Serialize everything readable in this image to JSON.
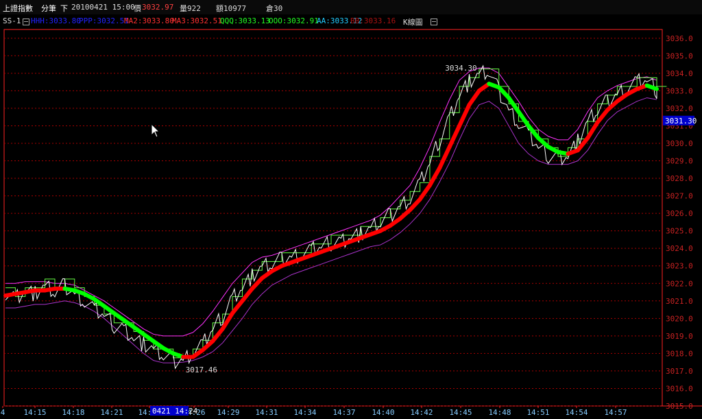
{
  "header": {
    "symbol": "上證指數",
    "period": "分筆",
    "direction": "下",
    "datetime": "20100421 15:00",
    "price_label": "價",
    "price_value": "3032.97",
    "volume": "量922",
    "amount": "額10977",
    "position": "倉30"
  },
  "legend": {
    "chart_name": "SS-1",
    "items": [
      {
        "text": "HHH:3033.80",
        "color": "#2222ff"
      },
      {
        "text": "PPP:3032.51",
        "color": "#2222ff"
      },
      {
        "text": "MA2:3033.80",
        "color": "#ff3030"
      },
      {
        "text": "MA3:3032.51",
        "color": "#ff3030"
      },
      {
        "text": "QQQ:3033.13",
        "color": "#22ff22"
      },
      {
        "text": "OOO:3032.91",
        "color": "#22ff22"
      },
      {
        "text": "AA:3033.12",
        "color": "#22ccff"
      },
      {
        "text": "BB:3033.16",
        "color": "#aa1111"
      },
      {
        "text": "K線圖",
        "color": "#dddddd"
      }
    ]
  },
  "colors": {
    "axis": "#ff2222",
    "grid": "#aa0000",
    "price_line": "#ffffff",
    "ma_up": "#ff0000",
    "ma_down": "#00ff00",
    "band_upper": "#ff33ff",
    "band_lower": "#aa33cc",
    "step_line": "#66ff44",
    "y_tick_text": "#cc2222",
    "x_tick_text": "#88ccff"
  },
  "chart_data": {
    "type": "line",
    "ylim": [
      3015,
      3036.5
    ],
    "y_ticks": [
      "3015.0",
      "3016.0",
      "3017.0",
      "3018.0",
      "3019.0",
      "3020.0",
      "3021.0",
      "3022.0",
      "3023.0",
      "3024.0",
      "3025.0",
      "3026.0",
      "3027.0",
      "3028.0",
      "3029.0",
      "3030.0",
      "3031.0",
      "3032.0",
      "3033.0",
      "3034.0",
      "3035.0",
      "3036.0"
    ],
    "x_ticks": [
      "4",
      "14:15",
      "14:18",
      "14:21",
      "14:24",
      "14:26",
      "14:29",
      "14:31",
      "14:34",
      "14:37",
      "14:40",
      "14:42",
      "14:45",
      "14:48",
      "14:51",
      "14:54",
      "14:57"
    ],
    "cursor_time": "0421 14:24",
    "current_value": "3031.30",
    "annotations": [
      {
        "text": "3017.46",
        "value": 3017.46,
        "label": "low"
      },
      {
        "text": "3034.30",
        "value": 3034.3,
        "label": "high"
      }
    ],
    "series": [
      {
        "name": "MA2",
        "values": [
          3021.3,
          3021.4,
          3021.5,
          3021.6,
          3021.6,
          3021.7,
          3021.7,
          3021.6,
          3021.4,
          3021.1,
          3020.7,
          3020.3,
          3019.9,
          3019.5,
          3019.1,
          3018.7,
          3018.3,
          3018.0,
          3017.8,
          3017.8,
          3018.2,
          3018.7,
          3019.4,
          3020.3,
          3021.0,
          3021.7,
          3022.3,
          3022.7,
          3023.0,
          3023.2,
          3023.4,
          3023.6,
          3023.8,
          3024.0,
          3024.2,
          3024.4,
          3024.6,
          3024.8,
          3025.0,
          3025.3,
          3025.7,
          3026.2,
          3026.8,
          3027.6,
          3028.6,
          3029.8,
          3031.0,
          3032.2,
          3033.0,
          3033.4,
          3033.2,
          3032.6,
          3031.8,
          3031.0,
          3030.3,
          3029.8,
          3029.5,
          3029.4,
          3029.6,
          3030.3,
          3031.2,
          3031.9,
          3032.4,
          3032.8,
          3033.1,
          3033.3,
          3033.1
        ]
      },
      {
        "name": "Price",
        "values": [
          3021.5,
          3021.2,
          3021.6,
          3021.4,
          3021.8,
          3021.5,
          3021.9,
          3021.4,
          3021.0,
          3020.5,
          3020.2,
          3019.6,
          3019.4,
          3018.9,
          3018.5,
          3018.2,
          3017.9,
          3017.6,
          3017.6,
          3018.1,
          3018.5,
          3019.4,
          3020.1,
          3021.2,
          3021.8,
          3022.4,
          3022.9,
          3023.1,
          3023.4,
          3023.5,
          3023.7,
          3023.9,
          3024.1,
          3024.3,
          3024.4,
          3024.7,
          3024.8,
          3025.1,
          3025.5,
          3025.9,
          3026.4,
          3026.9,
          3027.7,
          3028.9,
          3030.2,
          3031.5,
          3032.8,
          3033.5,
          3033.9,
          3034.1,
          3033.0,
          3031.9,
          3031.2,
          3030.5,
          3029.8,
          3029.3,
          3029.2,
          3029.3,
          3030.1,
          3031.2,
          3031.9,
          3032.4,
          3032.8,
          3033.2,
          3033.5,
          3033.6,
          3033.0
        ]
      },
      {
        "name": "Upper",
        "values": [
          3022.0,
          3022.0,
          3022.1,
          3022.1,
          3022.1,
          3022.0,
          3022.0,
          3021.9,
          3021.6,
          3021.3,
          3021.0,
          3020.6,
          3020.2,
          3019.8,
          3019.4,
          3019.1,
          3019.0,
          3019.0,
          3019.0,
          3019.2,
          3019.7,
          3020.4,
          3021.2,
          3022.0,
          3022.6,
          3023.2,
          3023.5,
          3023.6,
          3023.8,
          3024.0,
          3024.2,
          3024.4,
          3024.6,
          3024.8,
          3025.0,
          3025.2,
          3025.4,
          3025.6,
          3025.9,
          3026.4,
          3027.0,
          3027.6,
          3028.6,
          3029.8,
          3031.2,
          3032.5,
          3033.6,
          3034.1,
          3034.3,
          3034.3,
          3034.0,
          3033.2,
          3032.4,
          3031.5,
          3030.8,
          3030.4,
          3030.2,
          3030.2,
          3030.8,
          3031.8,
          3032.6,
          3033.0,
          3033.3,
          3033.5,
          3033.7,
          3033.8,
          3033.6
        ]
      },
      {
        "name": "Lower",
        "values": [
          3020.6,
          3020.6,
          3020.7,
          3020.8,
          3020.8,
          3020.9,
          3021.0,
          3020.9,
          3020.7,
          3020.4,
          3020.0,
          3019.5,
          3019.0,
          3018.5,
          3018.0,
          3017.6,
          3017.46,
          3017.46,
          3017.5,
          3017.6,
          3017.8,
          3018.1,
          3018.6,
          3019.3,
          3020.0,
          3020.8,
          3021.4,
          3021.9,
          3022.2,
          3022.5,
          3022.7,
          3022.9,
          3023.1,
          3023.3,
          3023.5,
          3023.7,
          3023.9,
          3024.1,
          3024.2,
          3024.5,
          3024.9,
          3025.4,
          3026.0,
          3026.8,
          3027.8,
          3028.9,
          3030.2,
          3031.4,
          3032.2,
          3032.4,
          3032.0,
          3031.0,
          3030.0,
          3029.4,
          3029.0,
          3028.8,
          3028.8,
          3028.8,
          3029.0,
          3029.6,
          3030.5,
          3031.3,
          3031.8,
          3032.1,
          3032.4,
          3032.6,
          3032.5
        ]
      }
    ]
  }
}
